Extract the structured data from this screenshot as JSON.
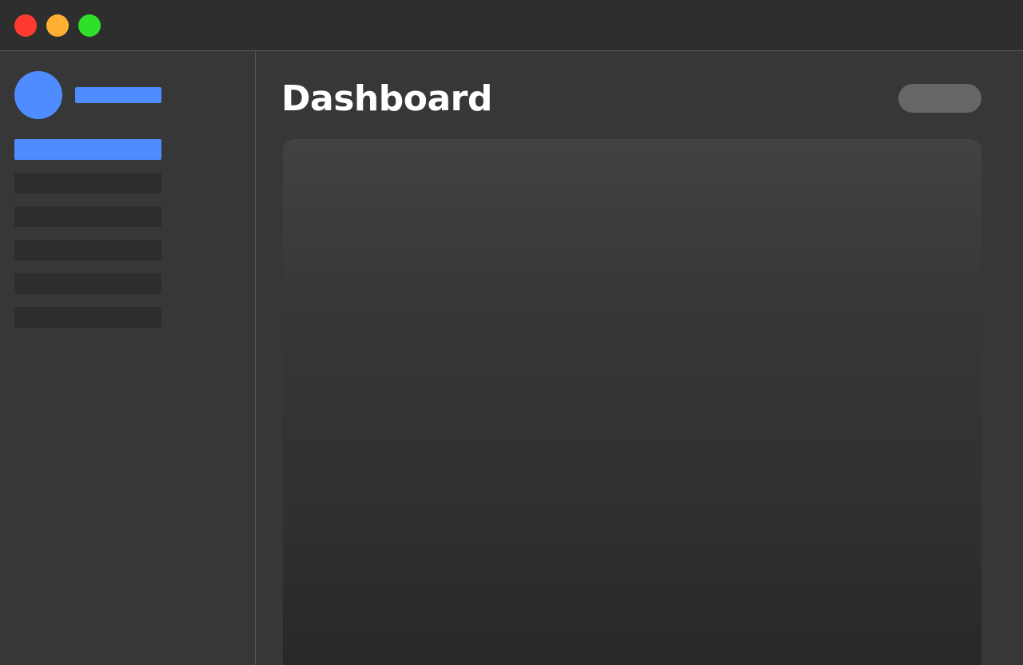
{
  "window": {
    "controls": [
      {
        "name": "close",
        "color": "#ff3b30"
      },
      {
        "name": "minimize",
        "color": "#ffb033"
      },
      {
        "name": "zoom",
        "color": "#2ee02a"
      }
    ]
  },
  "sidebar": {
    "avatar_color": "#4f8cff",
    "profile_bar_color": "#4f8cff",
    "items": [
      {
        "state": "active",
        "color": "#4f8cff"
      },
      {
        "state": "inactive",
        "color": "#2d2d2d"
      },
      {
        "state": "inactive",
        "color": "#2d2d2d"
      },
      {
        "state": "inactive",
        "color": "#2d2d2d"
      },
      {
        "state": "inactive",
        "color": "#2d2d2d"
      },
      {
        "state": "inactive",
        "color": "#2d2d2d"
      }
    ]
  },
  "main": {
    "title": "Dashboard",
    "header_pill_color": "#666666"
  },
  "colors": {
    "titlebar": "#2e2e2e",
    "background": "#363636",
    "accent": "#4f8cff",
    "divider": "#5a5a5a"
  }
}
